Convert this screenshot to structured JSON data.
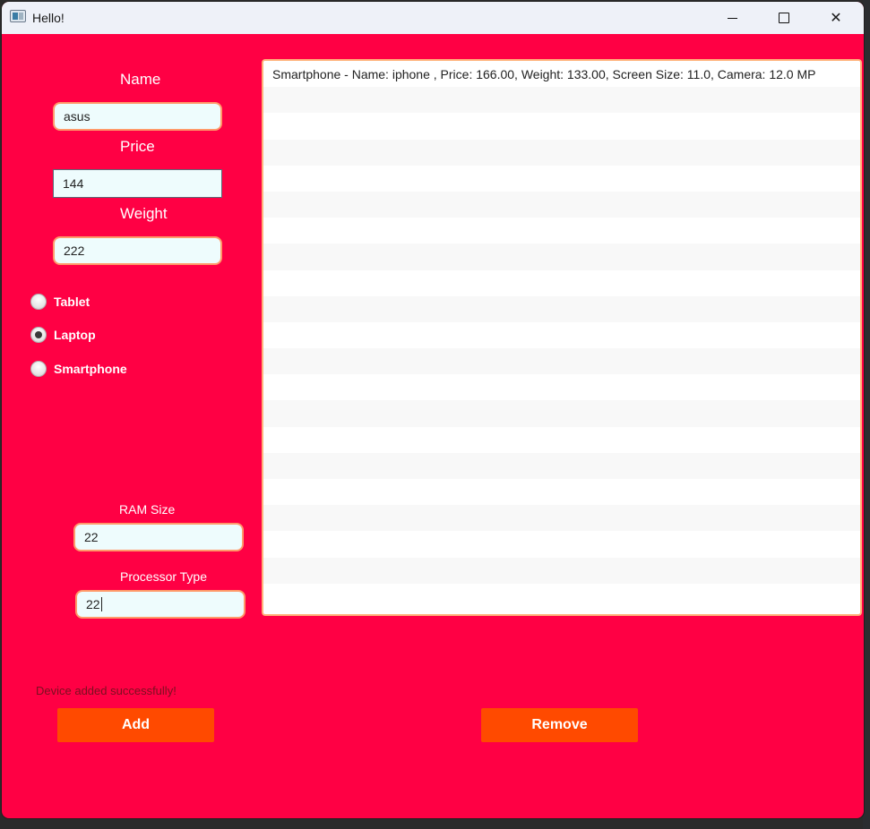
{
  "window": {
    "title": "Hello!"
  },
  "form": {
    "name_label": "Name",
    "name_value": "asus",
    "price_label": "Price",
    "price_value": "144",
    "weight_label": "Weight",
    "weight_value": "222",
    "device_types": [
      {
        "label": "Tablet",
        "selected": false
      },
      {
        "label": "Laptop",
        "selected": true
      },
      {
        "label": "Smartphone",
        "selected": false
      }
    ],
    "ram_label": "RAM Size",
    "ram_value": "22",
    "processor_label": "Processor Type",
    "processor_value": "22"
  },
  "status_message": "Device added successfully!",
  "buttons": {
    "add_label": "Add",
    "remove_label": "Remove"
  },
  "device_list": [
    "Smartphone - Name: iphone , Price: 166.00, Weight: 133.00, Screen Size: 11.0, Camera: 12.0 MP"
  ],
  "colors": {
    "window_bg": "#ff0044",
    "button_bg": "#ff4a00",
    "field_border": "#ff9a6a",
    "field_bg": "#eefcfd"
  }
}
